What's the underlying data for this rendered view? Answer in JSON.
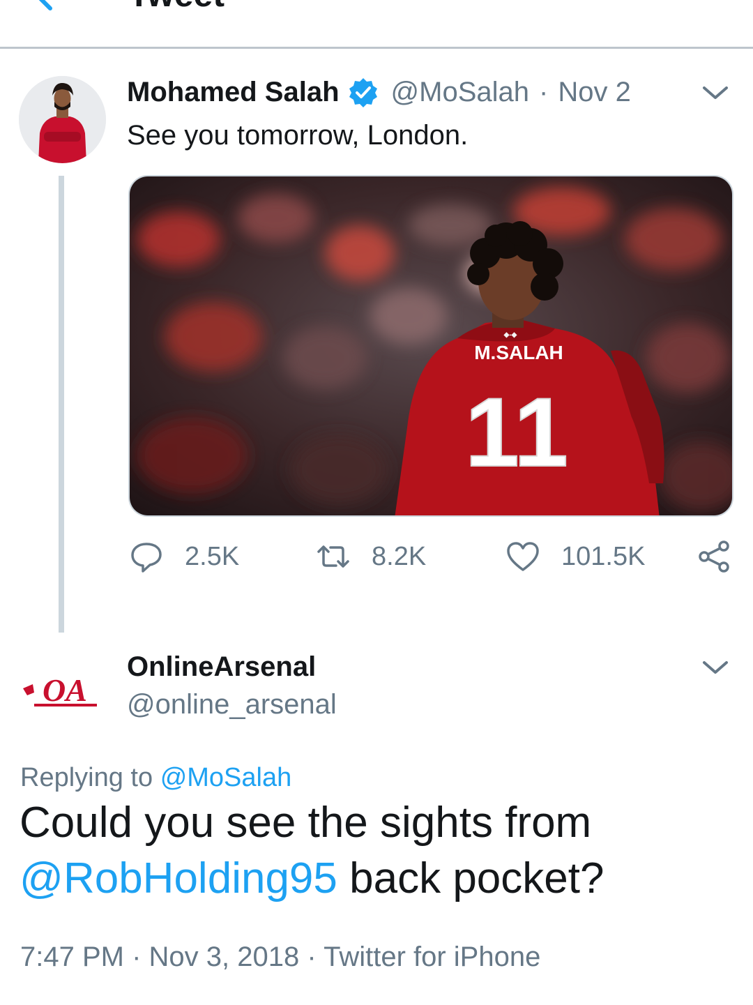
{
  "header": {
    "title": "Tweet"
  },
  "original_tweet": {
    "display_name": "Mohamed Salah",
    "handle": "@MoSalah",
    "separator": "·",
    "date": "Nov 2",
    "text": "See you tomorrow, London.",
    "media": {
      "name_on_shirt": "M.SALAH",
      "number_on_shirt": "11"
    },
    "actions": {
      "replies": "2.5K",
      "retweets": "8.2K",
      "likes": "101.5K"
    }
  },
  "reply": {
    "display_name": "OnlineArsenal",
    "handle": "@online_arsenal",
    "avatar_text": "OA",
    "replying_label": "Replying to",
    "replying_handle": "@MoSalah",
    "text_part1": "Could you see the sights from",
    "mention": "@RobHolding95",
    "text_part2": "back pocket?",
    "time": "7:47 PM",
    "date": "Nov 3, 2018",
    "source": "Twitter for iPhone",
    "separator": "·"
  },
  "colors": {
    "accent": "#1da1f2",
    "text_primary": "#14171a",
    "text_secondary": "#657786",
    "divider": "#ccd6dd",
    "liverpool_red": "#c8102e"
  },
  "icons": [
    "back-arrow-icon",
    "verified-badge-icon",
    "chevron-down-icon",
    "reply-icon",
    "retweet-icon",
    "like-icon",
    "share-icon"
  ]
}
